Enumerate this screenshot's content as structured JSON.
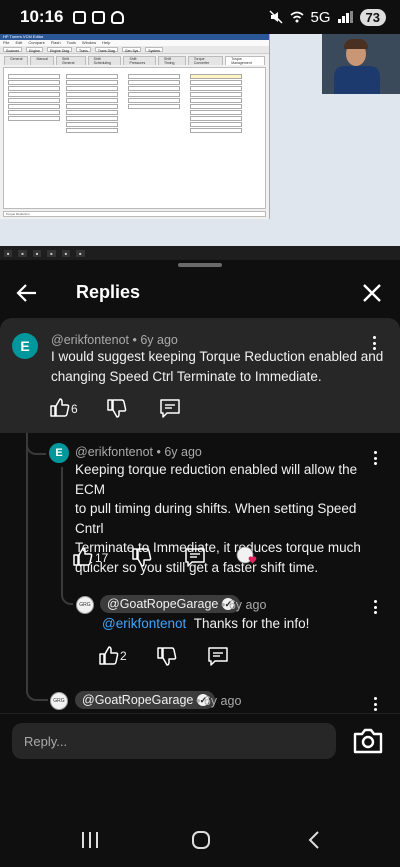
{
  "status_bar": {
    "time": "10:16",
    "network": "5G",
    "battery": "73"
  },
  "video": {
    "window_title": "HP Tuners VCM Editor",
    "menu": [
      "File",
      "Edit",
      "Compare",
      "Flash",
      "Tools",
      "Window",
      "Help"
    ],
    "toolbar": [
      "Scanner",
      "Engine",
      "Engine Diag",
      "Trans",
      "Trans Diag",
      "Gen Sys",
      "System"
    ],
    "tabs": [
      "General",
      "Manual",
      "Shift General",
      "Shift Scheduling",
      "Shift Pressures",
      "Shift Timing",
      "Torque Converter",
      "Torque Management"
    ],
    "status_text": "Torque Reduction"
  },
  "header": {
    "title": "Replies"
  },
  "comments": [
    {
      "avatar_letter": "E",
      "author": "@erikfontenot",
      "age": "6y ago",
      "text_lines": [
        "I would suggest keeping Torque Reduction enabled and",
        "changing Speed Ctrl Terminate to Immediate."
      ],
      "likes": "6"
    },
    {
      "avatar_letter": "E",
      "author": "@erikfontenot",
      "age": "6y ago",
      "text_lines": [
        "Keeping torque reduction enabled will allow the ECM",
        "to pull timing during shifts. When setting Speed Cntrl",
        "Terminate to Immediate, it reduces torque much",
        "quicker so you still get a faster shift time."
      ],
      "likes": "17"
    },
    {
      "author": "@GoatRopeGarage",
      "age": "6y ago",
      "mention": "@erikfontenot",
      "text": "Thanks for the info!",
      "likes": "2"
    },
    {
      "author": "@GoatRopeGarage",
      "age": "6y ago"
    }
  ],
  "reply_bar": {
    "placeholder": "Reply..."
  },
  "colors": {
    "background": "#0f0f0f",
    "card": "#272727",
    "accent_avatar": "#00979c",
    "mention": "#3ea6ff",
    "heart": "#e0245e"
  },
  "icons": [
    "back-arrow-icon",
    "close-icon",
    "thumbs-up-icon",
    "thumbs-down-icon",
    "reply-icon",
    "more-vert-icon",
    "camera-icon",
    "verified-icon",
    "creator-heart-icon"
  ]
}
